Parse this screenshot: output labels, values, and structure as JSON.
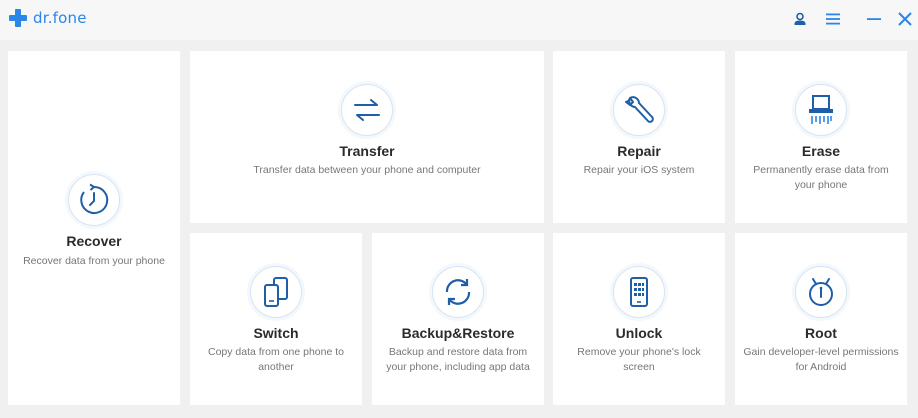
{
  "app": {
    "name": "dr.fone"
  },
  "colors": {
    "accent": "#2a86e8",
    "icon_blue": "#1f5fa8",
    "title": "#2b2b2b",
    "desc": "#777777"
  },
  "toolbar": {
    "account_icon": "user-icon",
    "menu_icon": "menu-icon",
    "minimize_icon": "minimize-icon",
    "close_icon": "close-icon"
  },
  "tiles": {
    "recover": {
      "title": "Recover",
      "desc": "Recover data from your phone",
      "icon": "clock-icon"
    },
    "transfer": {
      "title": "Transfer",
      "desc": "Transfer data between your phone and computer",
      "icon": "transfer-arrows-icon"
    },
    "repair": {
      "title": "Repair",
      "desc": "Repair your iOS system",
      "icon": "wrench-icon"
    },
    "erase": {
      "title": "Erase",
      "desc": "Permanently erase data from your phone",
      "icon": "shredder-icon"
    },
    "switch": {
      "title": "Switch",
      "desc": "Copy data from one phone to another",
      "icon": "switch-phones-icon"
    },
    "backup": {
      "title": "Backup&Restore",
      "desc": "Backup and restore data from your phone, including app data",
      "icon": "sync-icon"
    },
    "unlock": {
      "title": "Unlock",
      "desc": "Remove your phone's lock screen",
      "icon": "phone-keypad-icon"
    },
    "root": {
      "title": "Root",
      "desc": "Gain developer-level permissions for Android",
      "icon": "android-root-icon"
    }
  }
}
